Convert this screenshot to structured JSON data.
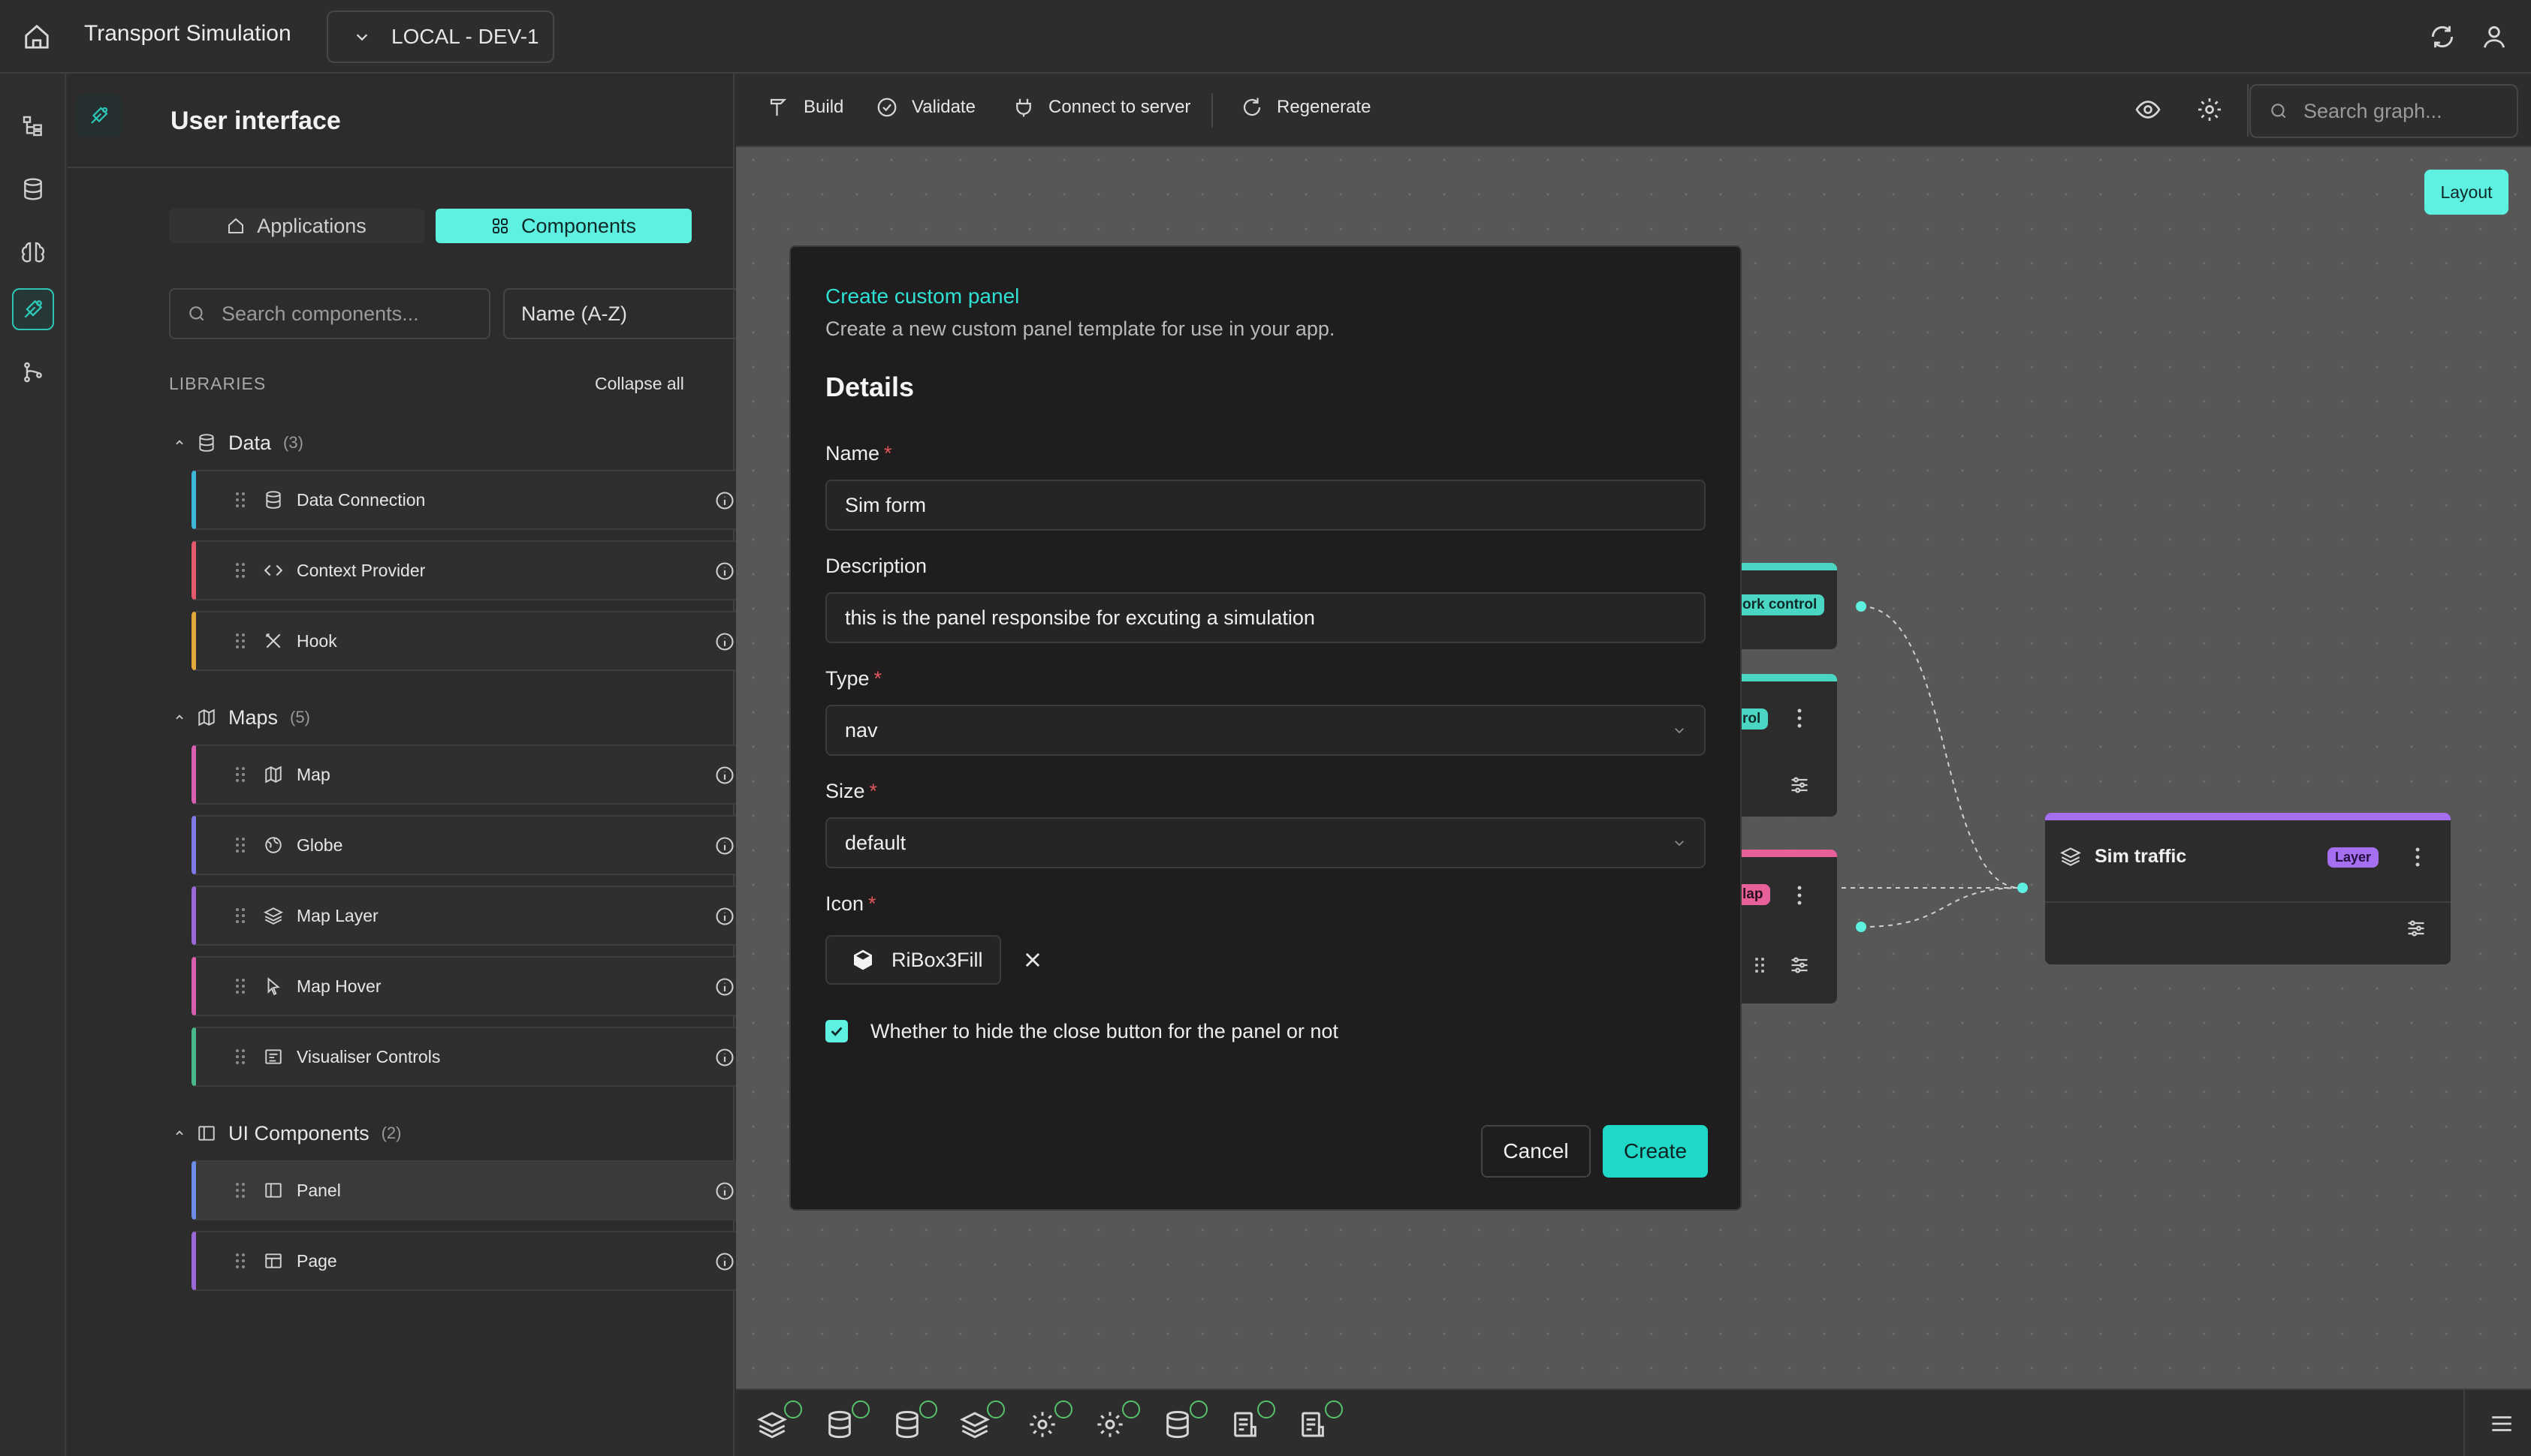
{
  "colors": {
    "accent": "#5ef0e0",
    "accent_text": "#2fe1d4",
    "required": "#e0575c",
    "check": "#57c26a",
    "data_lib": "#3fb7d8",
    "context_lib": "#e35b6c",
    "hook_lib": "#e4a93c",
    "map_lib": "#d85fb0",
    "globe_lib": "#7e7be8",
    "layer_lib": "#9b6ad8",
    "visual_lib": "#4bb88b",
    "panel_lib": "#6d8ee8"
  },
  "topbar": {
    "home_icon": "home-icon",
    "app_title": "Transport Simulation",
    "env": "LOCAL - DEV-1",
    "sync_icon": "sync-icon",
    "user_icon": "user-icon"
  },
  "rail": {
    "items": [
      "tree-icon",
      "database-icon",
      "brain-icon",
      "ui-builder-icon",
      "git-branch-icon"
    ],
    "active": 3
  },
  "side": {
    "title": "User interface",
    "tabs": {
      "applications": "Applications",
      "components": "Components"
    },
    "search_placeholder": "Search components...",
    "sort": "Name (A-Z)",
    "libraries_label": "LIBRARIES",
    "collapse_all": "Collapse all",
    "groups": [
      {
        "name": "Data",
        "count": "(3)",
        "items": [
          "Data Connection",
          "Context Provider",
          "Hook"
        ]
      },
      {
        "name": "Maps",
        "count": "(5)",
        "items": [
          "Map",
          "Globe",
          "Map Layer",
          "Map Hover",
          "Visualiser Controls"
        ]
      },
      {
        "name": "UI Components",
        "count": "(2)",
        "items": [
          "Panel",
          "Page"
        ]
      }
    ]
  },
  "toolbar": {
    "build": "Build",
    "validate": "Validate",
    "connect": "Connect to server",
    "regenerate": "Regenerate",
    "search_placeholder": "Search graph..."
  },
  "canvas": {
    "layout_button": "Layout",
    "partial_node_1_tag": "ork control",
    "partial_node_2_tag": "rol",
    "partial_node_3_tag": "lap",
    "sim_node": {
      "title": "Sim traffic",
      "tag": "Layer"
    }
  },
  "modal": {
    "title": "Create custom panel",
    "subtitle": "Create a new custom panel template for use in your app.",
    "section": "Details",
    "name_label": "Name",
    "name_value": "Sim form",
    "description_label": "Description",
    "description_value": "this is the panel responsibe for excuting a simulation",
    "type_label": "Type",
    "type_value": "nav",
    "size_label": "Size",
    "size_value": "default",
    "icon_label": "Icon",
    "icon_value": "RiBox3Fill",
    "required_mark": "*",
    "hide_close_checked": true,
    "hide_close_label": "Whether to hide the close button for the panel or not",
    "cancel": "Cancel",
    "create": "Create"
  },
  "bottombar": {
    "icons": [
      "layers-icon",
      "database-icon",
      "database-icon",
      "layers-icon",
      "gear-icon",
      "gear-icon",
      "database-icon",
      "document-list-icon",
      "document-list-icon"
    ],
    "menu_icon": "menu-icon"
  }
}
